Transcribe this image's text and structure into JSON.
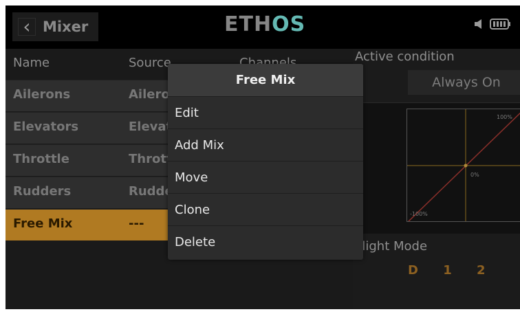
{
  "topbar": {
    "back_icon": "chevron-left-icon",
    "title": "Mixer",
    "logo_main": "ETH",
    "logo_accent": "OS",
    "status_icons": [
      "speaker-icon",
      "battery-icon"
    ]
  },
  "table": {
    "headers": [
      "Name",
      "Source",
      "Channels"
    ],
    "rows": [
      {
        "name": "Ailerons",
        "source": "Ailerons"
      },
      {
        "name": "Elevators",
        "source": "Elevators"
      },
      {
        "name": "Throttle",
        "source": "Throttle"
      },
      {
        "name": "Rudders",
        "source": "Rudders"
      },
      {
        "name": "Free Mix",
        "source": "---"
      }
    ],
    "selected_row": "Free Mix"
  },
  "right": {
    "active_condition_label": "Active condition",
    "active_condition_value": "Always On",
    "curve_labels": {
      "top": "100%",
      "mid": "0%",
      "bottom": "-100%"
    },
    "flight_mode_label": "Flight Mode",
    "flight_modes": [
      "D",
      "1",
      "2"
    ]
  },
  "popup": {
    "title": "Free Mix",
    "items": [
      "Edit",
      "Add Mix",
      "Move",
      "Clone",
      "Delete"
    ]
  },
  "colors": {
    "accent": "#b07a22",
    "logo_accent": "#64b9b3",
    "background": "#1d1d1d"
  }
}
